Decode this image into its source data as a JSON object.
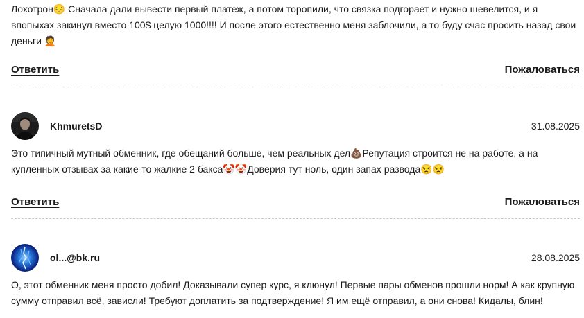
{
  "comments": [
    {
      "text_parts": [
        "Лохотрон",
        "😔",
        " Сначала дали вывести первый платеж, а потом торопили, что связка подгорает и нужно шевелится, и я впопыхах закинул вместо 100$ целую 1000!!!! И после этого естественно меня заблочили, а то буду счас просить назад свои деньги ",
        "🤦"
      ],
      "reply_label": "Ответить",
      "report_label": "Пожаловаться"
    },
    {
      "author": "KhmuretsD",
      "date": "31.08.2025",
      "text_parts": [
        "Это типичный мутный обменник, где обещаний больше, чем реальных дел",
        "💩",
        "Репутация строится не на работе, а на купленных отзывах за какие-то жалкие 2 бакса",
        "🤡🤡",
        "Доверия тут ноль, один запах развода",
        "😒😒"
      ],
      "reply_label": "Ответить",
      "report_label": "Пожаловаться"
    },
    {
      "author": "ol...@bk.ru",
      "date": "28.08.2025",
      "text": "О, этот обменник меня просто добил! Доказывали супер курс, я клюнул! Первые пары обменов прошли норм! А как крупную сумму отправил всё, зависли! Требуют доплатить за подтверждение! Я им ещё отправил, а они снова! Кидалы, блин!"
    }
  ]
}
